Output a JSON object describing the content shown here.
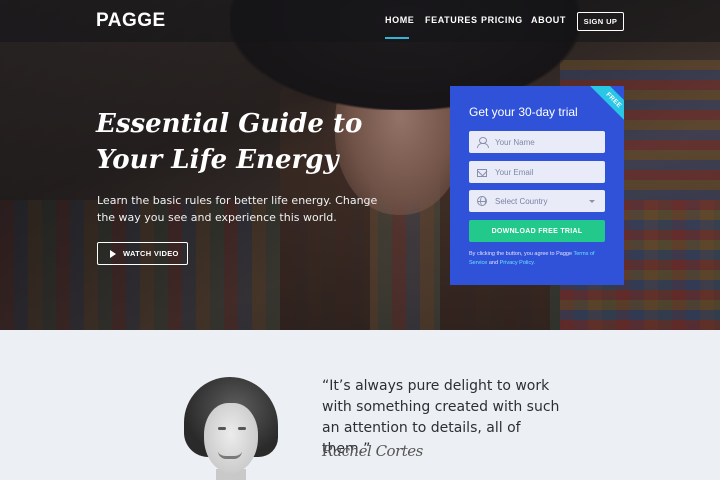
{
  "nav": {
    "logo": "PAGGE",
    "links": [
      "HOME",
      "FEATURES",
      "PRICING",
      "ABOUT"
    ],
    "active_link": "HOME",
    "signup_label": "SIGN UP",
    "accent_color": "#34b3d9"
  },
  "hero": {
    "headline_line1": "Essential Guide to",
    "headline_line2": "Your Life Energy",
    "subtext": "Learn the basic rules for better life energy. Change the way you see and experience this world.",
    "watch_video_label": "WATCH VIDEO",
    "watch_video_icon": "play-icon"
  },
  "signup_card": {
    "title": "Get your 30-day trial",
    "ribbon": "FREE",
    "name_placeholder": "Your Name",
    "email_placeholder": "Your Email",
    "country_placeholder": "Select Country",
    "submit_label": "DOWNLOAD FREE TRIAL",
    "terms_prefix": "By clicking the button, you agree to Pagge",
    "terms_link": "Terms of Service",
    "terms_and": "and",
    "privacy_link": "Privacy Policy.",
    "card_color": "#2f52d8",
    "ribbon_color": "#29c6e6",
    "button_color": "#22c98a"
  },
  "testimonial": {
    "quote": "“It’s always pure delight to work with something created with such an attention to details, all of them.”",
    "signature": "Rachel Cortes"
  }
}
